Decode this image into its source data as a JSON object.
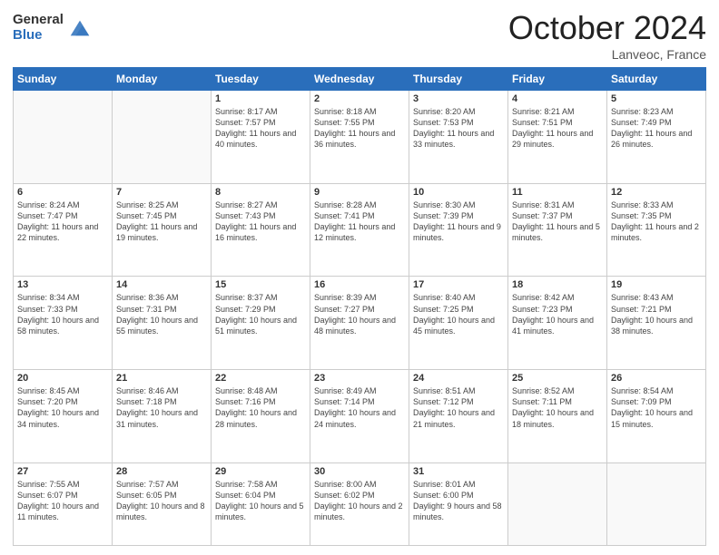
{
  "logo": {
    "general": "General",
    "blue": "Blue"
  },
  "title": {
    "month": "October 2024",
    "location": "Lanveoc, France"
  },
  "header_days": [
    "Sunday",
    "Monday",
    "Tuesday",
    "Wednesday",
    "Thursday",
    "Friday",
    "Saturday"
  ],
  "weeks": [
    [
      {
        "day": "",
        "sunrise": "",
        "sunset": "",
        "daylight": ""
      },
      {
        "day": "",
        "sunrise": "",
        "sunset": "",
        "daylight": ""
      },
      {
        "day": "1",
        "sunrise": "Sunrise: 8:17 AM",
        "sunset": "Sunset: 7:57 PM",
        "daylight": "Daylight: 11 hours and 40 minutes."
      },
      {
        "day": "2",
        "sunrise": "Sunrise: 8:18 AM",
        "sunset": "Sunset: 7:55 PM",
        "daylight": "Daylight: 11 hours and 36 minutes."
      },
      {
        "day": "3",
        "sunrise": "Sunrise: 8:20 AM",
        "sunset": "Sunset: 7:53 PM",
        "daylight": "Daylight: 11 hours and 33 minutes."
      },
      {
        "day": "4",
        "sunrise": "Sunrise: 8:21 AM",
        "sunset": "Sunset: 7:51 PM",
        "daylight": "Daylight: 11 hours and 29 minutes."
      },
      {
        "day": "5",
        "sunrise": "Sunrise: 8:23 AM",
        "sunset": "Sunset: 7:49 PM",
        "daylight": "Daylight: 11 hours and 26 minutes."
      }
    ],
    [
      {
        "day": "6",
        "sunrise": "Sunrise: 8:24 AM",
        "sunset": "Sunset: 7:47 PM",
        "daylight": "Daylight: 11 hours and 22 minutes."
      },
      {
        "day": "7",
        "sunrise": "Sunrise: 8:25 AM",
        "sunset": "Sunset: 7:45 PM",
        "daylight": "Daylight: 11 hours and 19 minutes."
      },
      {
        "day": "8",
        "sunrise": "Sunrise: 8:27 AM",
        "sunset": "Sunset: 7:43 PM",
        "daylight": "Daylight: 11 hours and 16 minutes."
      },
      {
        "day": "9",
        "sunrise": "Sunrise: 8:28 AM",
        "sunset": "Sunset: 7:41 PM",
        "daylight": "Daylight: 11 hours and 12 minutes."
      },
      {
        "day": "10",
        "sunrise": "Sunrise: 8:30 AM",
        "sunset": "Sunset: 7:39 PM",
        "daylight": "Daylight: 11 hours and 9 minutes."
      },
      {
        "day": "11",
        "sunrise": "Sunrise: 8:31 AM",
        "sunset": "Sunset: 7:37 PM",
        "daylight": "Daylight: 11 hours and 5 minutes."
      },
      {
        "day": "12",
        "sunrise": "Sunrise: 8:33 AM",
        "sunset": "Sunset: 7:35 PM",
        "daylight": "Daylight: 11 hours and 2 minutes."
      }
    ],
    [
      {
        "day": "13",
        "sunrise": "Sunrise: 8:34 AM",
        "sunset": "Sunset: 7:33 PM",
        "daylight": "Daylight: 10 hours and 58 minutes."
      },
      {
        "day": "14",
        "sunrise": "Sunrise: 8:36 AM",
        "sunset": "Sunset: 7:31 PM",
        "daylight": "Daylight: 10 hours and 55 minutes."
      },
      {
        "day": "15",
        "sunrise": "Sunrise: 8:37 AM",
        "sunset": "Sunset: 7:29 PM",
        "daylight": "Daylight: 10 hours and 51 minutes."
      },
      {
        "day": "16",
        "sunrise": "Sunrise: 8:39 AM",
        "sunset": "Sunset: 7:27 PM",
        "daylight": "Daylight: 10 hours and 48 minutes."
      },
      {
        "day": "17",
        "sunrise": "Sunrise: 8:40 AM",
        "sunset": "Sunset: 7:25 PM",
        "daylight": "Daylight: 10 hours and 45 minutes."
      },
      {
        "day": "18",
        "sunrise": "Sunrise: 8:42 AM",
        "sunset": "Sunset: 7:23 PM",
        "daylight": "Daylight: 10 hours and 41 minutes."
      },
      {
        "day": "19",
        "sunrise": "Sunrise: 8:43 AM",
        "sunset": "Sunset: 7:21 PM",
        "daylight": "Daylight: 10 hours and 38 minutes."
      }
    ],
    [
      {
        "day": "20",
        "sunrise": "Sunrise: 8:45 AM",
        "sunset": "Sunset: 7:20 PM",
        "daylight": "Daylight: 10 hours and 34 minutes."
      },
      {
        "day": "21",
        "sunrise": "Sunrise: 8:46 AM",
        "sunset": "Sunset: 7:18 PM",
        "daylight": "Daylight: 10 hours and 31 minutes."
      },
      {
        "day": "22",
        "sunrise": "Sunrise: 8:48 AM",
        "sunset": "Sunset: 7:16 PM",
        "daylight": "Daylight: 10 hours and 28 minutes."
      },
      {
        "day": "23",
        "sunrise": "Sunrise: 8:49 AM",
        "sunset": "Sunset: 7:14 PM",
        "daylight": "Daylight: 10 hours and 24 minutes."
      },
      {
        "day": "24",
        "sunrise": "Sunrise: 8:51 AM",
        "sunset": "Sunset: 7:12 PM",
        "daylight": "Daylight: 10 hours and 21 minutes."
      },
      {
        "day": "25",
        "sunrise": "Sunrise: 8:52 AM",
        "sunset": "Sunset: 7:11 PM",
        "daylight": "Daylight: 10 hours and 18 minutes."
      },
      {
        "day": "26",
        "sunrise": "Sunrise: 8:54 AM",
        "sunset": "Sunset: 7:09 PM",
        "daylight": "Daylight: 10 hours and 15 minutes."
      }
    ],
    [
      {
        "day": "27",
        "sunrise": "Sunrise: 7:55 AM",
        "sunset": "Sunset: 6:07 PM",
        "daylight": "Daylight: 10 hours and 11 minutes."
      },
      {
        "day": "28",
        "sunrise": "Sunrise: 7:57 AM",
        "sunset": "Sunset: 6:05 PM",
        "daylight": "Daylight: 10 hours and 8 minutes."
      },
      {
        "day": "29",
        "sunrise": "Sunrise: 7:58 AM",
        "sunset": "Sunset: 6:04 PM",
        "daylight": "Daylight: 10 hours and 5 minutes."
      },
      {
        "day": "30",
        "sunrise": "Sunrise: 8:00 AM",
        "sunset": "Sunset: 6:02 PM",
        "daylight": "Daylight: 10 hours and 2 minutes."
      },
      {
        "day": "31",
        "sunrise": "Sunrise: 8:01 AM",
        "sunset": "Sunset: 6:00 PM",
        "daylight": "Daylight: 9 hours and 58 minutes."
      },
      {
        "day": "",
        "sunrise": "",
        "sunset": "",
        "daylight": ""
      },
      {
        "day": "",
        "sunrise": "",
        "sunset": "",
        "daylight": ""
      }
    ]
  ]
}
